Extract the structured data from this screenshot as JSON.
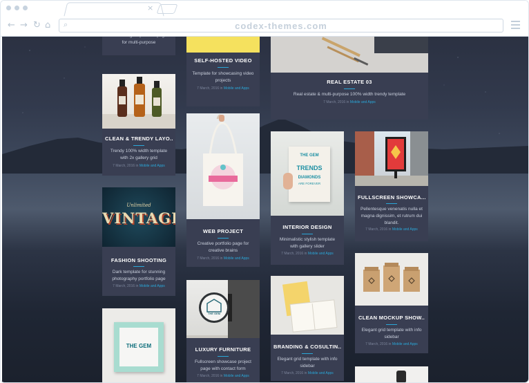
{
  "browser": {
    "url": "codex-themes.com",
    "tab_close": "×",
    "back_glyph": "←",
    "forward_glyph": "→",
    "reload_glyph": "↻",
    "home_glyph": "⌂",
    "search_glyph": "⌕"
  },
  "colors": {
    "accent": "#2aa8d9",
    "card_bg": "#393e52",
    "title": "#ffffff"
  },
  "cards": [
    {
      "id": "col1-top",
      "title": "",
      "desc": "Clean elegant portfolio page for multi-purpose",
      "date": "",
      "in": "",
      "category": ""
    },
    {
      "id": "clean-trendy",
      "title": "CLEAN & TRENDY LAYO..",
      "desc": "Trendy 100% width template with 2x gallery grid",
      "date": "7 March, 2016",
      "in": "in",
      "category": "Mobile and Apps"
    },
    {
      "id": "fashion-shooting",
      "title": "FASHION SHOOTING",
      "desc": "Dark template for stunning photography portfolio page",
      "date": "7 March, 2016",
      "in": "in",
      "category": "Mobile and Apps"
    },
    {
      "id": "self-hosted",
      "title": "SELF-HOSTED VIDEO",
      "desc": "Template for showcasing video projects",
      "date": "7 March, 2016",
      "in": "in",
      "category": "Mobile and Apps"
    },
    {
      "id": "web-project",
      "title": "WEB PROJECT",
      "desc": "Creative portfolio page for creative brains",
      "date": "7 March, 2016",
      "in": "in",
      "category": "Mobile and Apps"
    },
    {
      "id": "luxury-furniture",
      "title": "LUXURY FURNITURE",
      "desc": "Fullscreen showcase project page with contact form",
      "date": "7 March, 2016",
      "in": "in",
      "category": "Mobile and Apps"
    },
    {
      "id": "real-estate",
      "title": "REAL ESTATE 03",
      "desc": "Real estate & multi-purpose 100% width trendy template",
      "date": "7 March, 2016",
      "in": "in",
      "category": "Mobile and Apps"
    },
    {
      "id": "interior-design",
      "title": "INTERIOR DESIGN",
      "desc": "Minimalistic stylish template with gallery slider",
      "date": "7 March, 2016",
      "in": "in",
      "category": "Mobile and Apps"
    },
    {
      "id": "branding",
      "title": "BRANDING & COSULTIN..",
      "desc": "Elegant grid template with info sidebar",
      "date": "7 March, 2016",
      "in": "in",
      "category": "Mobile and Apps"
    },
    {
      "id": "fullscreen-showcase",
      "title": "FULLSCREEN SHOWCA...",
      "desc": "Pellentesque venenatis nulla et magna dignissim, et rutrum dui blandit.",
      "date": "7 March, 2016",
      "in": "in",
      "category": "Mobile and Apps"
    },
    {
      "id": "clean-mockup",
      "title": "CLEAN MOCKUP SHOW..",
      "desc": "Elegant grid template with info sidebar",
      "date": "7 March, 2016",
      "in": "in",
      "category": "Mobile and Apps"
    }
  ],
  "thumb_text": {
    "vintage_small": "Unlimited",
    "vintage_big": "VINTAGE",
    "book_brand": "THE GEM",
    "book_line1": "TRENDS",
    "book_line2": "DIAMONDS",
    "book_line3": "ARE FOREVER",
    "frame_brand": "THE GEM",
    "sign_brand": "THE GEM"
  }
}
